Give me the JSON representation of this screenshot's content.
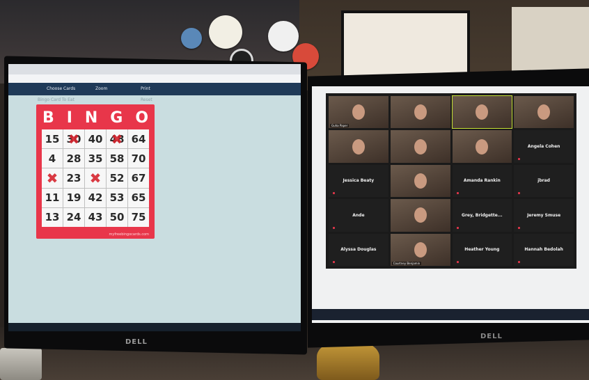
{
  "bingo_page": {
    "toolbar": {
      "choose_cards": "Choose Cards",
      "zoom_label": "Zoom",
      "print_label": "Print"
    },
    "card_caption_left": "Bingo Card To Eat",
    "card_caption_right": "Reset",
    "letters": [
      "B",
      "I",
      "N",
      "G",
      "O"
    ],
    "rows": [
      [
        "15",
        "30",
        "40",
        "48",
        "64"
      ],
      [
        "4",
        "28",
        "35",
        "58",
        "70"
      ],
      [
        "",
        "23",
        "",
        "52",
        "67"
      ],
      [
        "11",
        "19",
        "42",
        "53",
        "65"
      ],
      [
        "13",
        "24",
        "43",
        "50",
        "75"
      ]
    ],
    "marked": [
      [
        0,
        1
      ],
      [
        0,
        3
      ],
      [
        2,
        0
      ],
      [
        2,
        2
      ]
    ],
    "footer": "myfreebingocards.com"
  },
  "left_monitor_brand": "DELL",
  "right_monitor_brand": "DELL",
  "zoom_tiles": [
    {
      "kind": "video",
      "name": "Guha Paper"
    },
    {
      "kind": "video",
      "name": ""
    },
    {
      "kind": "video",
      "name": "",
      "active": true
    },
    {
      "kind": "video",
      "name": ""
    },
    {
      "kind": "video",
      "name": ""
    },
    {
      "kind": "video",
      "name": ""
    },
    {
      "kind": "video",
      "name": ""
    },
    {
      "kind": "name",
      "name": "Angela Cohen"
    },
    {
      "kind": "name",
      "name": "Jessica Beaty"
    },
    {
      "kind": "video",
      "name": ""
    },
    {
      "kind": "name",
      "name": "Amanda Rankin"
    },
    {
      "kind": "name",
      "name": "jbrad"
    },
    {
      "kind": "name",
      "name": "Ande"
    },
    {
      "kind": "video",
      "name": ""
    },
    {
      "kind": "name",
      "name": "Grey, Bridgette..."
    },
    {
      "kind": "name",
      "name": "Jeremy Smuse"
    },
    {
      "kind": "name",
      "name": "Alyssa Douglas"
    },
    {
      "kind": "video",
      "name": "Courtney Benjamin"
    },
    {
      "kind": "name",
      "name": "Heather Young"
    },
    {
      "kind": "name",
      "name": "Hannah Bedolah"
    }
  ],
  "colors": {
    "bingo_red": "#e8364a",
    "active_speaker": "#c6e234",
    "toolbar_navy": "#1f3a58"
  }
}
